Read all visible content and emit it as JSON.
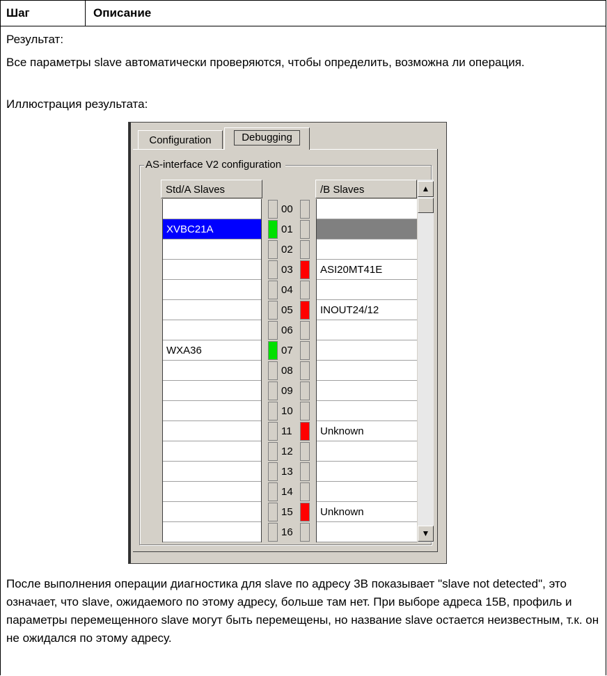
{
  "table": {
    "header": {
      "step": "Шаг",
      "description": "Описание"
    },
    "result_label": "Результат:",
    "paragraph1": "Все параметры slave автоматически проверяются, чтобы определить, возможна ли операция.",
    "illustration_label": "Иллюстрация результата:",
    "paragraph2": "После выполнения операции диагностика для slave по адресу 3B показывает \"slave not detected\", это означает, что slave, ожидаемого по этому адресу, больше там нет. При выборе адреса 15B, профиль и параметры перемещенного slave могут быть перемещены, но название slave остается неизвестным, т.к. он не ожидался по этому адресу."
  },
  "screenshot": {
    "tabs": [
      {
        "label": "Configuration",
        "active": false
      },
      {
        "label": "Debugging",
        "active": true
      }
    ],
    "group_title": "AS-interface V2 configuration",
    "std_header": "Std/A Slaves",
    "b_header": "/B Slaves",
    "addresses": [
      "00",
      "01",
      "02",
      "03",
      "04",
      "05",
      "06",
      "07",
      "08",
      "09",
      "10",
      "11",
      "12",
      "13",
      "14",
      "15",
      "16"
    ],
    "std_slaves": [
      "",
      "XVBC21A",
      "",
      "",
      "",
      "",
      "",
      "WXA36",
      "",
      "",
      "",
      "",
      "",
      "",
      "",
      "",
      ""
    ],
    "b_slaves": [
      "",
      "",
      "",
      "ASI20MT41E",
      "",
      "INOUT24/12",
      "",
      "",
      "",
      "",
      "",
      "Unknown",
      "",
      "",
      "",
      "Unknown",
      ""
    ],
    "std_led_status": [
      "off",
      "green",
      "off",
      "off",
      "off",
      "off",
      "off",
      "green",
      "off",
      "off",
      "off",
      "off",
      "off",
      "off",
      "off",
      "off",
      "off"
    ],
    "b_led_status": [
      "off",
      "off",
      "off",
      "red",
      "off",
      "red",
      "off",
      "off",
      "off",
      "off",
      "off",
      "red",
      "off",
      "off",
      "off",
      "red",
      "off"
    ],
    "std_selected_index": 1,
    "b_greyed_index": 1,
    "status_colors": {
      "green": "#00e000",
      "red": "#ff0000",
      "selection": "#0000ff"
    },
    "scroll_icons": {
      "up": "triangle-up-icon",
      "down": "triangle-down-icon"
    }
  }
}
